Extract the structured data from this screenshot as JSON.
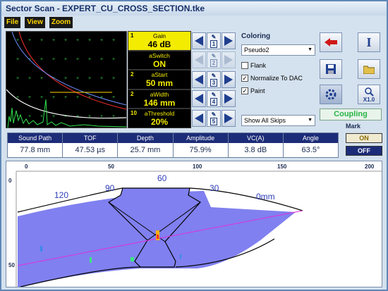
{
  "window": {
    "title": "Sector Scan - EXPERT_CU_CROSS_SECTION.tke"
  },
  "menu": [
    "File",
    "View",
    "Zoom"
  ],
  "params": [
    {
      "index": "1",
      "name": "Gain",
      "value": "46 dB"
    },
    {
      "index": "",
      "name": "aSwitch",
      "value": "ON"
    },
    {
      "index": "2",
      "name": "aStart",
      "value": "50 mm"
    },
    {
      "index": "2",
      "name": "aWidth",
      "value": "146 mm"
    },
    {
      "index": "10",
      "name": "aThreshold",
      "value": "20%"
    }
  ],
  "param_buttons": [
    "1",
    "2",
    "3",
    "4",
    "5"
  ],
  "coloring": {
    "label": "Coloring",
    "selected": "Pseudo2",
    "flank": "Flank",
    "normalize": "Normalize To DAC",
    "paint": "Paint",
    "skips": "Show All Skips"
  },
  "toolbar": {
    "zoom_label": "X1.0",
    "info_label": "I"
  },
  "coupling": "Coupling",
  "mark": {
    "label": "Mark",
    "on": "ON",
    "off": "OFF"
  },
  "readouts": [
    {
      "name": "Sound Path",
      "value": "77.8 mm"
    },
    {
      "name": "TOF",
      "value": "47.53 µs"
    },
    {
      "name": "Depth",
      "value": "25.7 mm"
    },
    {
      "name": "Amplitude",
      "value": "75.9%"
    },
    {
      "name": "VC(A)",
      "value": "3.8 dB"
    },
    {
      "name": "Angle",
      "value": "63.5°"
    }
  ],
  "scan": {
    "x_ticks": [
      "0",
      "50",
      "100",
      "150",
      "200"
    ],
    "y_ticks": [
      "0",
      "50"
    ],
    "angle_labels": [
      "120",
      "90",
      "60",
      "30",
      "0mm"
    ]
  },
  "colors": {
    "beam_fill": "#8080f0",
    "param_yellow": "#f4ec00",
    "header_blue": "#1c2c78"
  }
}
